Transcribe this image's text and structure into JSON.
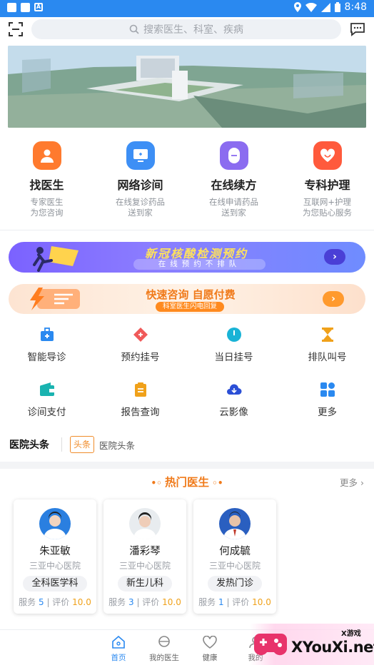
{
  "status_bar": {
    "time": "8:48"
  },
  "search": {
    "placeholder": "搜索医生、科室、疾病"
  },
  "features": [
    {
      "title": "找医生",
      "sub1": "专家医生",
      "sub2": "为您咨询",
      "color": "#ff7a2e",
      "icon": "doctor-icon"
    },
    {
      "title": "网络诊间",
      "sub1": "在线复诊药品",
      "sub2": "送到家",
      "color": "#3d8ff5",
      "icon": "monitor-icon"
    },
    {
      "title": "在线续方",
      "sub1": "在线申请药品",
      "sub2": "送到家",
      "color": "#8b6cf0",
      "icon": "pill-icon"
    },
    {
      "title": "专科护理",
      "sub1": "互联网+护理",
      "sub2": "为您贴心服务",
      "color": "#ff5a3c",
      "icon": "heart-icon"
    }
  ],
  "promo1": {
    "title": "新冠核酸检测预约",
    "subtitle": "在线预约不排队"
  },
  "promo2": {
    "title": "快速咨询 自愿付费",
    "subtitle": "科室医生闪电回复"
  },
  "quick_grid": [
    [
      {
        "label": "智能导诊",
        "icon": "medkit-icon"
      },
      {
        "label": "预约挂号",
        "icon": "diamond-icon"
      },
      {
        "label": "当日挂号",
        "icon": "clock-icon"
      },
      {
        "label": "排队叫号",
        "icon": "hourglass-icon"
      }
    ],
    [
      {
        "label": "诊间支付",
        "icon": "wallet-icon"
      },
      {
        "label": "报告查询",
        "icon": "clipboard-icon"
      },
      {
        "label": "云影像",
        "icon": "cloud-icon"
      },
      {
        "label": "更多",
        "icon": "grid-icon"
      }
    ]
  ],
  "headline": {
    "logo": "医院头条",
    "tag": "头条",
    "text": "医院头条"
  },
  "hot_doctors": {
    "title": "热门医生",
    "more": "更多",
    "service_label": "服务",
    "rating_label": "评价",
    "doctors": [
      {
        "name": "朱亚敏",
        "hospital": "三亚中心医院",
        "department": "全科医学科",
        "service": "5",
        "rating": "10.0"
      },
      {
        "name": "潘彩琴",
        "hospital": "三亚中心医院",
        "department": "新生儿科",
        "service": "3",
        "rating": "10.0"
      },
      {
        "name": "何成毓",
        "hospital": "三亚中心医院",
        "department": "发热门诊",
        "service": "1",
        "rating": "10.0"
      }
    ]
  },
  "bottom_nav": [
    {
      "label": "首页",
      "active": true
    },
    {
      "label": "我的医生",
      "active": false
    },
    {
      "label": "健康",
      "active": false
    },
    {
      "label": "我的",
      "active": false
    }
  ],
  "watermark": {
    "brand": "XYouXi.net",
    "top": "X游戏"
  }
}
